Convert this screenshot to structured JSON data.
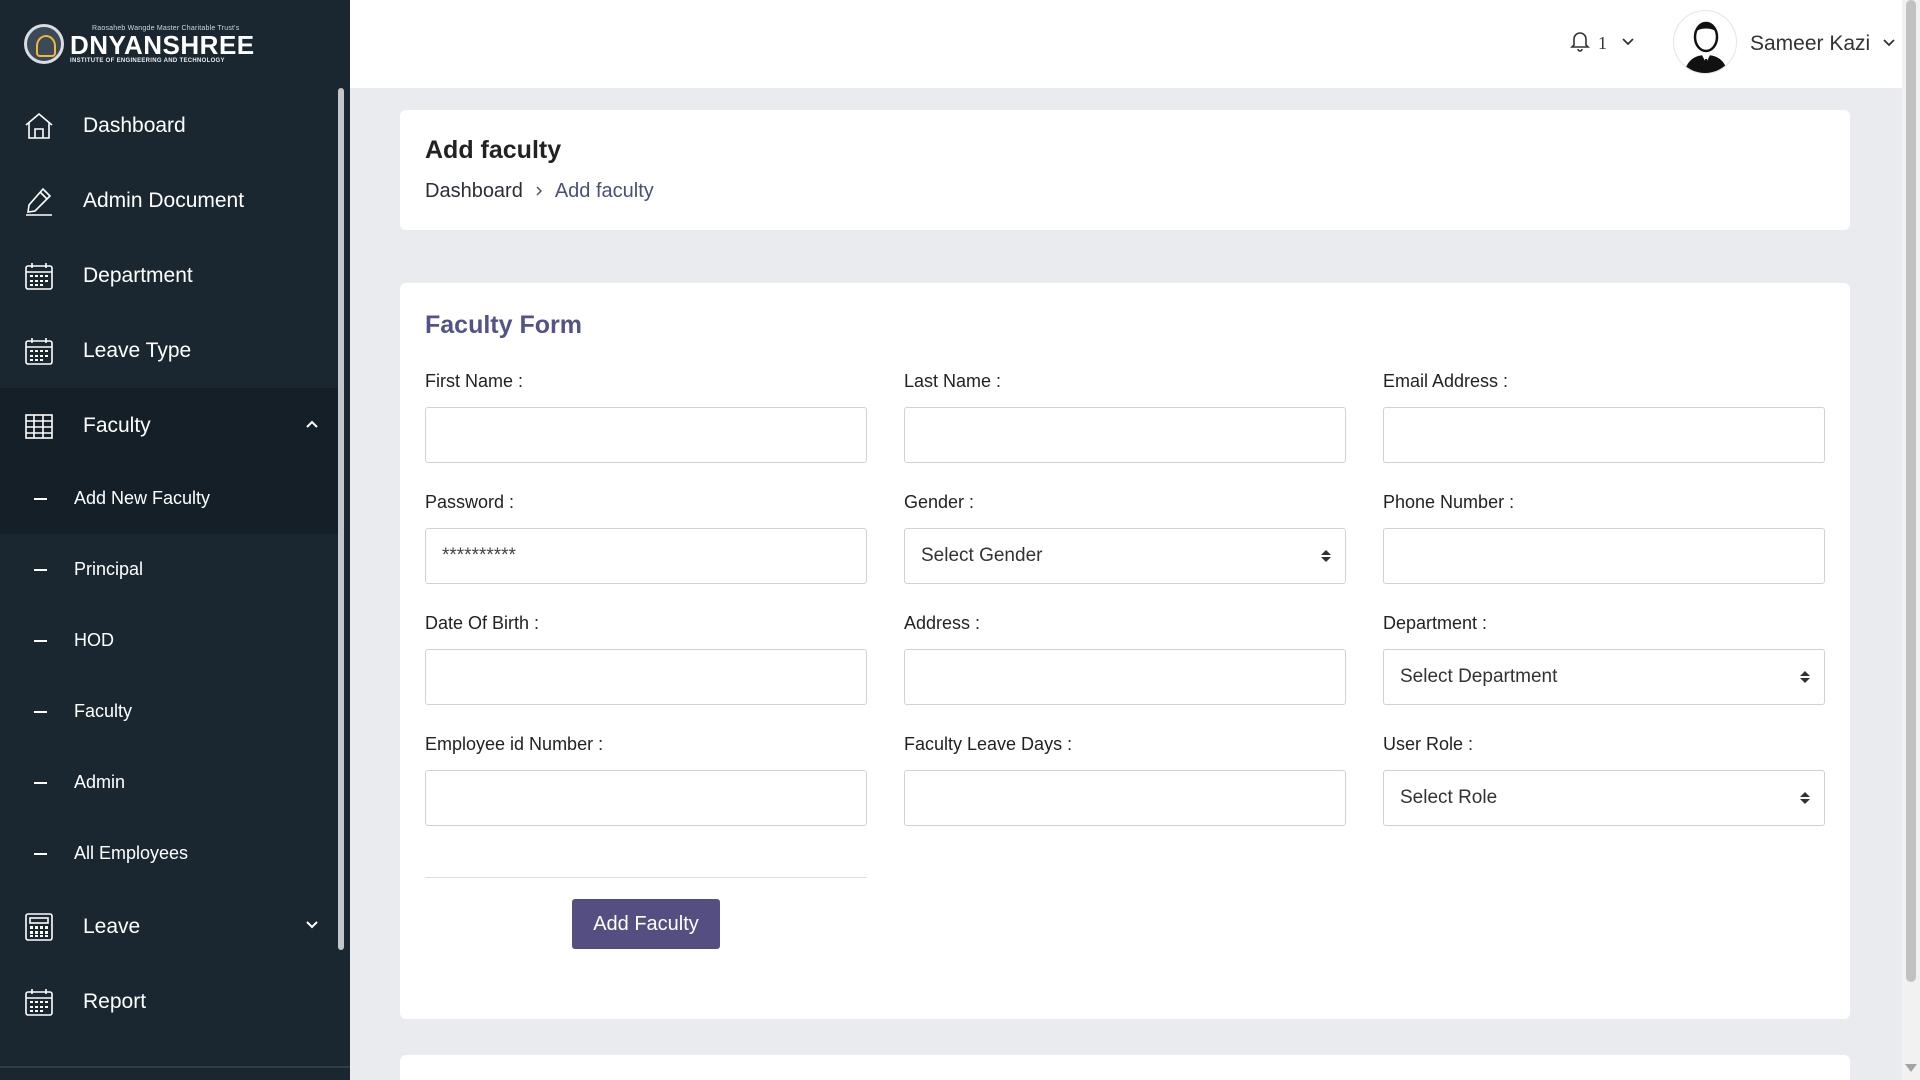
{
  "brand": {
    "tagline": "Raosaheb Wangde Master Charitable Trust's",
    "name": "DNYANSHREE",
    "subtitle": "INSTITUTE OF ENGINEERING AND TECHNOLOGY"
  },
  "sidebar": {
    "items": [
      {
        "label": "Dashboard",
        "icon": "home-icon"
      },
      {
        "label": "Admin Document",
        "icon": "pencil-icon"
      },
      {
        "label": "Department",
        "icon": "calendar-icon"
      },
      {
        "label": "Leave Type",
        "icon": "calendar-icon"
      },
      {
        "label": "Faculty",
        "icon": "grid-icon",
        "expanded": true
      },
      {
        "label": "Leave",
        "icon": "calculator-icon",
        "expanded": false
      },
      {
        "label": "Report",
        "icon": "calendar-icon"
      }
    ],
    "faculty_sub": [
      {
        "label": "Add New Faculty",
        "active": true
      },
      {
        "label": "Principal"
      },
      {
        "label": "HOD"
      },
      {
        "label": "Faculty"
      },
      {
        "label": "Admin"
      },
      {
        "label": "All Employees"
      }
    ]
  },
  "topbar": {
    "notification_count": "1",
    "user_name": "Sameer Kazi"
  },
  "page": {
    "title": "Add faculty",
    "breadcrumb": {
      "home": "Dashboard",
      "current": "Add faculty"
    }
  },
  "form": {
    "title": "Faculty Form",
    "first_name_label": "First Name :",
    "last_name_label": "Last Name :",
    "email_label": "Email Address :",
    "password_label": "Password :",
    "password_placeholder": "**********",
    "gender_label": "Gender :",
    "gender_value": "Select Gender",
    "phone_label": "Phone Number :",
    "dob_label": "Date Of Birth :",
    "address_label": "Address :",
    "department_label": "Department :",
    "department_value": "Select Department",
    "employee_id_label": "Employee id Number :",
    "leave_days_label": "Faculty Leave Days :",
    "role_label": "User Role :",
    "role_value": "Select Role",
    "submit_label": "Add Faculty"
  },
  "colors": {
    "sidebar_bg": "#1b2730",
    "sidebar_active_bg": "#151f27",
    "accent": "#544f80",
    "form_title": "#545388",
    "page_bg": "#e9ebef"
  }
}
